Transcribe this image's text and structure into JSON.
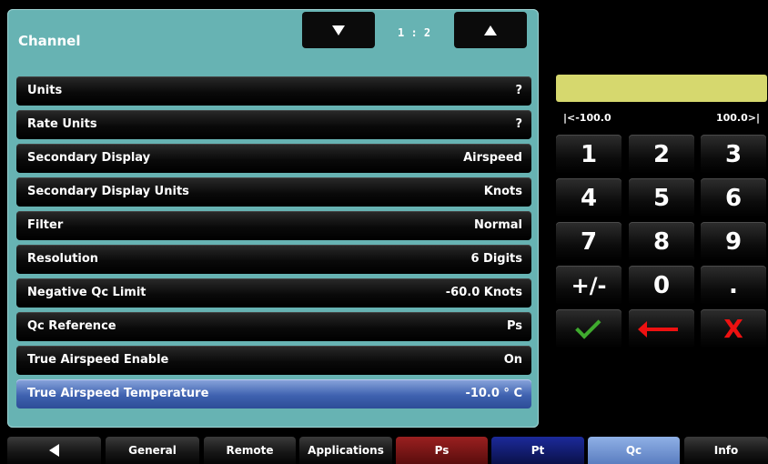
{
  "panel": {
    "title": "Channel",
    "page_indicator": "1 : 2",
    "rows": [
      {
        "label": "Units",
        "value": "?"
      },
      {
        "label": "Rate Units",
        "value": "?"
      },
      {
        "label": "Secondary Display",
        "value": "Airspeed"
      },
      {
        "label": "Secondary Display Units",
        "value": "Knots"
      },
      {
        "label": "Filter",
        "value": "Normal"
      },
      {
        "label": "Resolution",
        "value": "6 Digits"
      },
      {
        "label": "Negative Qc Limit",
        "value": "-60.0 Knots"
      },
      {
        "label": "Qc Reference",
        "value": "Ps"
      },
      {
        "label": "True Airspeed Enable",
        "value": "On"
      },
      {
        "label": "True Airspeed Temperature",
        "value": "-10.0 ° C"
      }
    ]
  },
  "keypad": {
    "entry_value": "",
    "min_label": "|<-100.0",
    "max_label": "100.0>|",
    "keys": [
      "1",
      "2",
      "3",
      "4",
      "5",
      "6",
      "7",
      "8",
      "9",
      "+/-",
      "0",
      "."
    ]
  },
  "tabs": [
    {
      "label": "",
      "icon": "back-arrow-icon"
    },
    {
      "label": "General"
    },
    {
      "label": "Remote"
    },
    {
      "label": "Applications"
    },
    {
      "label": "Ps"
    },
    {
      "label": "Pt"
    },
    {
      "label": "Qc"
    },
    {
      "label": "Info"
    }
  ],
  "colors": {
    "panel_bg": "#67b3b3",
    "entry_bg": "#d6d86e",
    "selected_row": "#3f62b0",
    "tab_ps": "#7a1414",
    "tab_pt": "#101a6e",
    "tab_qc": "#6f90cf",
    "accept": "#3faa2e",
    "cancel": "#e11111"
  }
}
